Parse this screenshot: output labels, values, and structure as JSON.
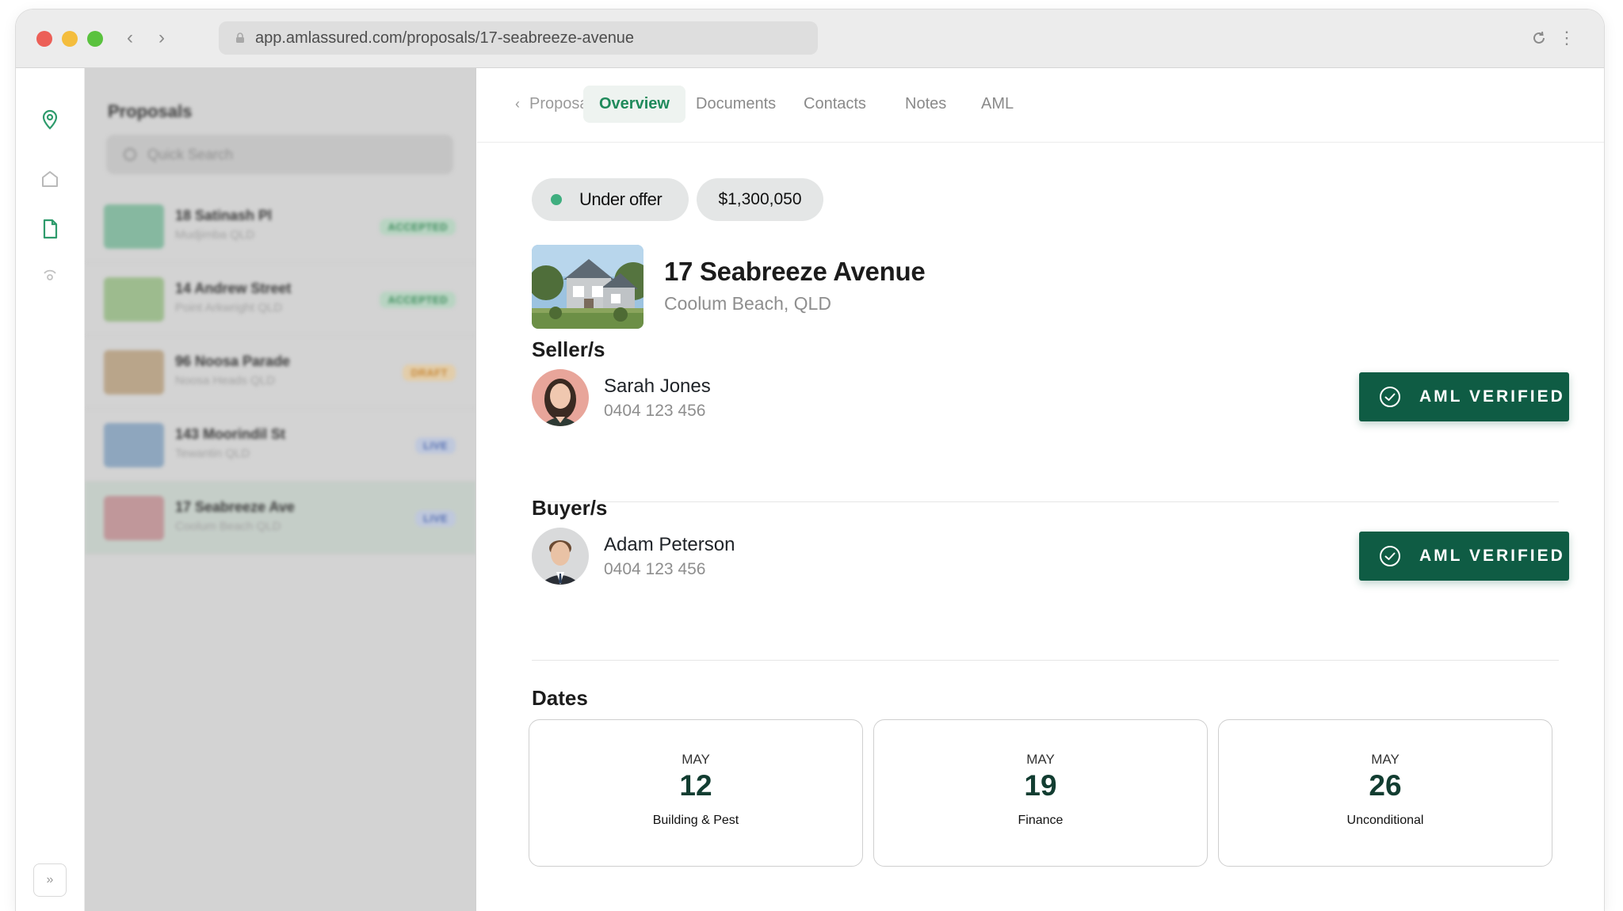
{
  "browser": {
    "url": "app.amlassured.com/proposals/17-seabreeze-avenue"
  },
  "list_panel": {
    "title": "Proposals",
    "search_placeholder": "Quick Search",
    "items": [
      {
        "name": "18 Satinash Pl",
        "suburb": "Mudjimba QLD",
        "badge": "ACCEPTED",
        "thumb_color": "#86b8a0"
      },
      {
        "name": "14 Andrew Street",
        "suburb": "Point Arkwright QLD",
        "badge": "ACCEPTED",
        "thumb_color": "#9dbb8e"
      },
      {
        "name": "96 Noosa Parade",
        "suburb": "Noosa Heads QLD",
        "badge": "DRAFT",
        "thumb_color": "#b9a58a"
      },
      {
        "name": "143 Moorindil St",
        "suburb": "Tewantin QLD",
        "badge": "LIVE",
        "thumb_color": "#8ea6be"
      },
      {
        "name": "17 Seabreeze Ave",
        "suburb": "Coolum Beach QLD",
        "badge": "LIVE",
        "thumb_color": "#c0979a"
      }
    ]
  },
  "tabs": {
    "back_label": "Proposals",
    "items": [
      "Overview",
      "Documents",
      "Contacts",
      "Notes",
      "AML"
    ],
    "active": "Overview"
  },
  "property": {
    "status": "Under offer",
    "price": "$1,300,050",
    "address": "17 Seabreeze Avenue",
    "suburb": "Coolum Beach, QLD"
  },
  "sellers": {
    "heading": "Seller/s",
    "name": "Sarah Jones",
    "phone": "0404 123 456",
    "aml_label": "AML VERIFIED"
  },
  "buyers": {
    "heading": "Buyer/s",
    "name": "Adam Peterson",
    "phone": "0404 123 456",
    "aml_label": "AML VERIFIED"
  },
  "dates": {
    "heading": "Dates",
    "items": [
      {
        "month": "MAY",
        "day": "12",
        "label": "Building & Pest"
      },
      {
        "month": "MAY",
        "day": "19",
        "label": "Finance"
      },
      {
        "month": "MAY",
        "day": "26",
        "label": "Unconditional"
      }
    ]
  },
  "colors": {
    "accent_green": "#0f5c44",
    "tab_active": "#1f8a5b",
    "status_dot": "#3fae7f"
  },
  "icons": {
    "rail": [
      "location-pin-icon",
      "home-icon",
      "document-icon",
      "settings-icon"
    ],
    "aml": "check-circle-icon"
  }
}
